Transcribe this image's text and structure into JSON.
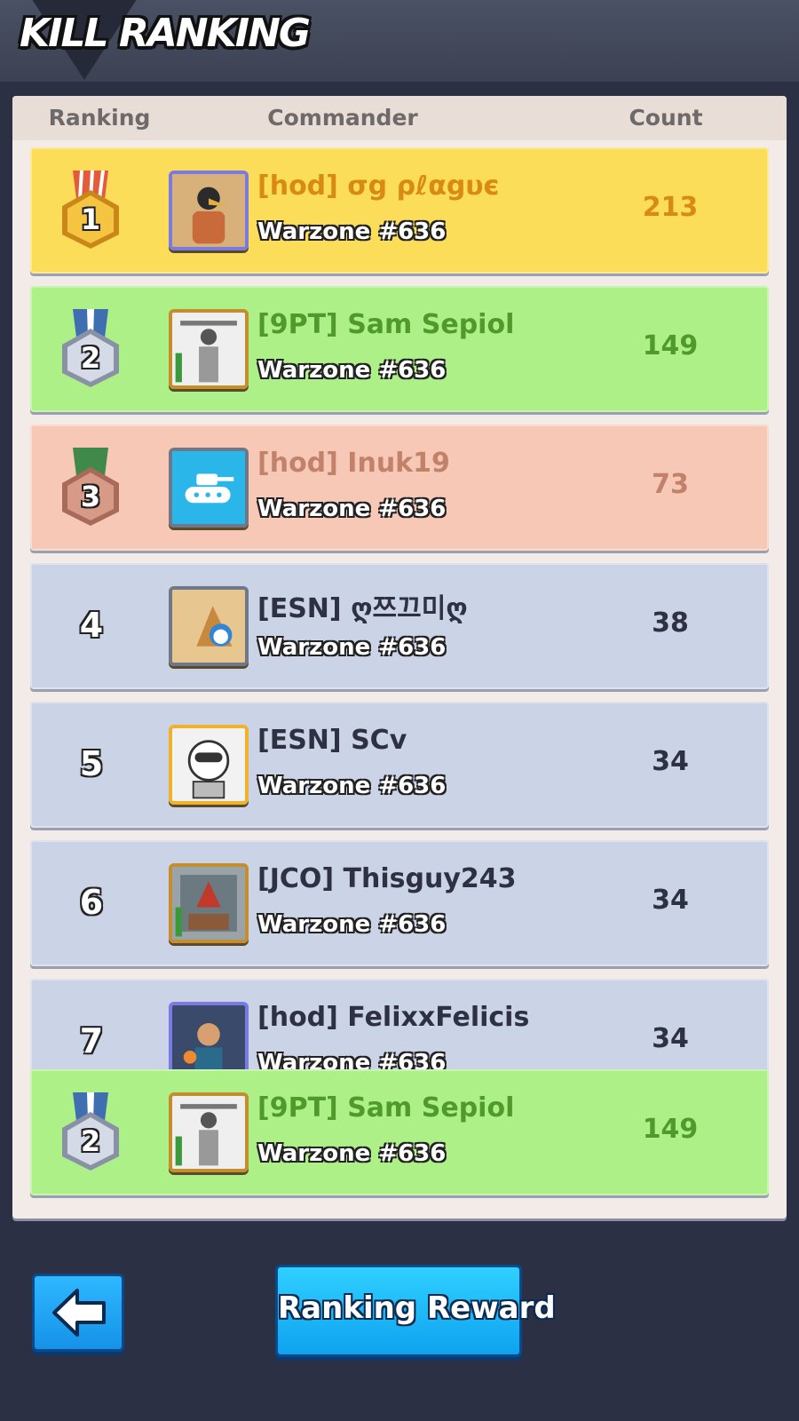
{
  "header": {
    "title": "KILL RANKING"
  },
  "columns": {
    "ranking": "Ranking",
    "commander": "Commander",
    "count": "Count"
  },
  "rows": [
    {
      "rank": "1",
      "tier": "gold",
      "name": "[hod] σg ρℓαgυє",
      "zone": "Warzone #636",
      "count": "213",
      "avatar_icon": "bird-warrior-avatar-icon"
    },
    {
      "rank": "2",
      "tier": "silver",
      "name": "[9PT] Sam Sepiol",
      "zone": "Warzone #636",
      "count": "149",
      "avatar_icon": "samurai-avatar-icon"
    },
    {
      "rank": "3",
      "tier": "bronze",
      "name": "[hod] Inuk19",
      "zone": "Warzone #636",
      "count": "73",
      "avatar_icon": "tank-avatar-icon"
    },
    {
      "rank": "4",
      "tier": "plain",
      "name": "[ESN] ღ쯔끄미ღ",
      "zone": "Warzone #636",
      "count": "38",
      "avatar_icon": "pyramid-avatar-icon"
    },
    {
      "rank": "5",
      "tier": "plain",
      "name": "[ESN] SCv",
      "zone": "Warzone #636",
      "count": "34",
      "avatar_icon": "astronaut-avatar-icon"
    },
    {
      "rank": "6",
      "tier": "plain",
      "name": "[JCO] Thisguy243",
      "zone": "Warzone #636",
      "count": "34",
      "avatar_icon": "dragon-avatar-icon"
    },
    {
      "rank": "7",
      "tier": "plain",
      "name": "[hod] FelixxFelicis",
      "zone": "Warzone #636",
      "count": "34",
      "avatar_icon": "hero-avatar-icon"
    }
  ],
  "self_row": {
    "rank": "2",
    "tier": "silver",
    "name": "[9PT] Sam Sepiol",
    "zone": "Warzone #636",
    "count": "149",
    "avatar_icon": "samurai-avatar-icon"
  },
  "buttons": {
    "back_icon": "arrow-left-icon",
    "reward_label": "Ranking Reward"
  },
  "colors": {
    "gold": "#fcdd5a",
    "silver": "#acf087",
    "bronze": "#f6c8b5",
    "plain": "#cbd3e6",
    "button": "#1aa6f2"
  }
}
